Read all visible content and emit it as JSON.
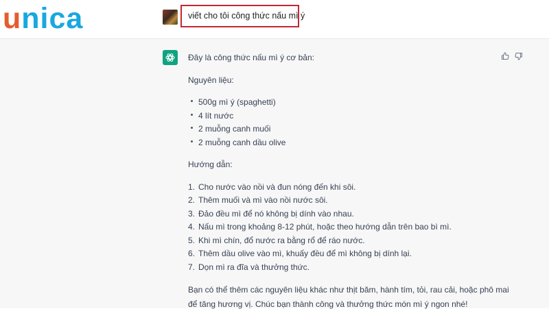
{
  "brand": {
    "logo_first": "u",
    "logo_rest": "nica"
  },
  "user_message": {
    "text": "viết cho tôi công thức nấu mì ý"
  },
  "assistant": {
    "intro": "Đây là công thức nấu mì ý cơ bản:",
    "ingredients_heading": "Nguyên liệu:",
    "ingredients": [
      "500g mì ý (spaghetti)",
      "4 lít nước",
      "2 muỗng canh muối",
      "2 muỗng canh dầu olive"
    ],
    "instructions_heading": "Hướng dẫn:",
    "steps": [
      {
        "num": "1.",
        "text": "Cho nước vào nồi và đun nóng đến khi sôi."
      },
      {
        "num": "2.",
        "text": "Thêm muối và mì vào nồi nước sôi."
      },
      {
        "num": "3.",
        "text": "Đảo đều mì để nó không bị dính vào nhau."
      },
      {
        "num": "4.",
        "text": "Nấu mì trong khoảng 8-12 phút, hoặc theo hướng dẫn trên bao bì mì."
      },
      {
        "num": "5.",
        "text": "Khi mì chín, đổ nước ra bằng rổ để ráo nước."
      },
      {
        "num": "6.",
        "text": "Thêm dầu olive vào mì, khuấy đều để mì không bị dính lại."
      },
      {
        "num": "7.",
        "text": "Dọn mì ra đĩa và thưởng thức."
      }
    ],
    "closing": "Bạn có thể thêm các nguyên liệu khác như thịt băm, hành tím, tỏi, rau cải, hoặc phô mai để tăng hương vị. Chúc bạn thành công và thưởng thức món mì ý ngon nhé!"
  },
  "icons": {
    "bot": "openai-logo-icon",
    "thumbs_up": "thumbs-up-icon",
    "thumbs_down": "thumbs-down-icon"
  },
  "colors": {
    "logo_orange": "#e55c2e",
    "logo_blue": "#1aa7e0",
    "bot_green": "#10a37f",
    "highlight_red": "#c4262e"
  }
}
